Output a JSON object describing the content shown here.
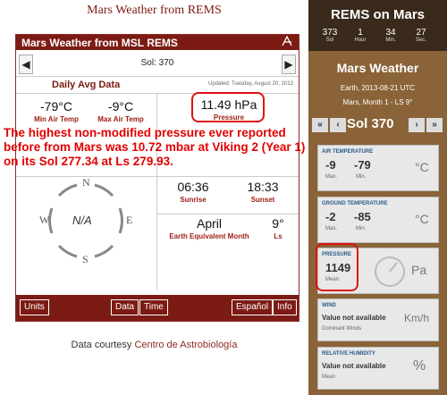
{
  "page": {
    "top_title": "Mars Weather from REMS"
  },
  "widget": {
    "header": "Mars Weather from MSL REMS",
    "prev_arrow": "◀",
    "next_arrow": "▶",
    "sol_label": "Sol: 370",
    "daily_title": "Daily Avg Data",
    "updated": "Updated: Tuesday, August 20, 2013",
    "min_air_temp": "-79°C",
    "min_air_label": "Min Air Temp",
    "max_air_temp": "-9°C",
    "max_air_label": "Max Air Temp",
    "pressure": "11.49 hPa",
    "pressure_label": "Pressure",
    "compass": {
      "n": "N",
      "s": "S",
      "e": "E",
      "w": "W",
      "center": "N/A"
    },
    "sunrise": "06:36",
    "sunrise_label": "Sunrise",
    "sunset": "18:33",
    "sunset_label": "Sunset",
    "month": "April",
    "month_label": "Earth Equivalent Month",
    "ls": "9°",
    "ls_label": "Ls",
    "buttons": {
      "units": "Units",
      "data": "Data",
      "time": "Time",
      "espanol": "Español",
      "info": "Info"
    }
  },
  "annotation": "The highest non-modified pressure ever reported before from Mars was 10.72 mbar at Viking 2 (Year 1) on its Sol 277.34 at Ls 279.93.",
  "credit": {
    "prefix": "Data courtesy ",
    "link": "Centro de Astrobiología"
  },
  "panel": {
    "title": "REMS on Mars",
    "time": [
      {
        "n": "373",
        "u": "Sol"
      },
      {
        "n": "1",
        "u": "Hour"
      },
      {
        "n": "34",
        "u": "Min."
      },
      {
        "n": "27",
        "u": "Sec."
      }
    ],
    "weather_title": "Mars Weather",
    "earth_date": "Earth, 2013-08-21 UTC",
    "mars_date": "Mars, Month 1 - LS 9°",
    "nav": {
      "first": "«",
      "prev": "‹",
      "next": "›",
      "last": "»"
    },
    "sol": "Sol 370",
    "air": {
      "title": "AIR TEMPERATURE",
      "max": "-9",
      "max_l": "Max.",
      "min": "-79",
      "min_l": "Min.",
      "unit": "°C"
    },
    "ground": {
      "title": "GROUND TEMPERATURE",
      "max": "-2",
      "max_l": "Max.",
      "min": "-85",
      "min_l": "Min.",
      "unit": "°C"
    },
    "pressure": {
      "title": "PRESSURE",
      "value": "1149",
      "label": "Mean",
      "unit": "Pa"
    },
    "wind": {
      "title": "WIND",
      "value": "Value not available",
      "label": "Dominant Winds",
      "unit": "Km/h"
    },
    "humidity": {
      "title": "RELATIVE HUMIDITY",
      "value": "Value not available",
      "label": "Mean",
      "unit": "%"
    }
  },
  "colors": {
    "brand": "#7c1b14",
    "highlight": "#e01010",
    "annotation": "#e20000",
    "panel": "#8a6338"
  }
}
